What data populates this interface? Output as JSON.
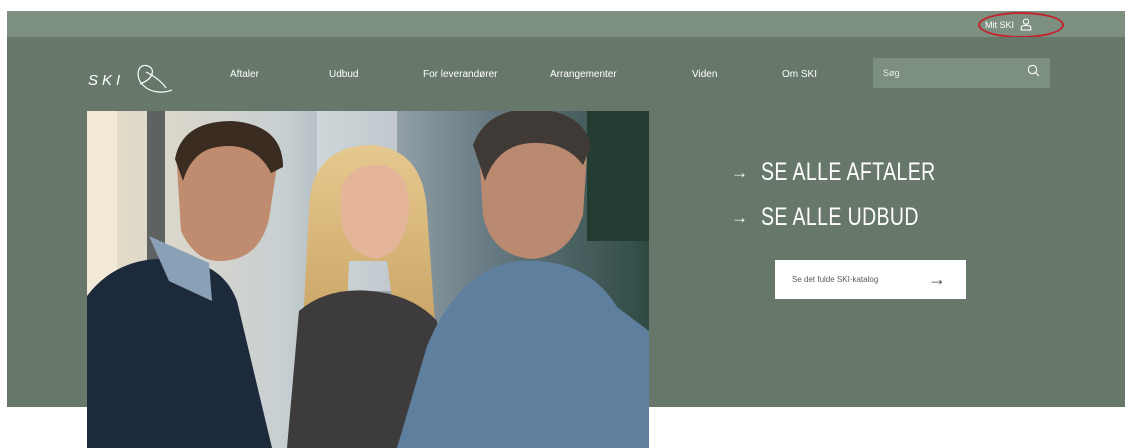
{
  "topbar": {
    "mit_ski_label": "Mit SKI",
    "profile_icon": "user-icon"
  },
  "header": {
    "logo_text": "SKI",
    "nav": [
      {
        "label": "Aftaler"
      },
      {
        "label": "Udbud"
      },
      {
        "label": "For leverandører"
      },
      {
        "label": "Arrangementer"
      },
      {
        "label": "Viden"
      },
      {
        "label": "Om SKI"
      }
    ],
    "search": {
      "placeholder": "Søg",
      "icon": "search-icon"
    }
  },
  "hero": {
    "links": [
      {
        "label": "SE ALLE AFTALER"
      },
      {
        "label": "SE ALLE UDBUD"
      }
    ],
    "catalog_button": "Se det fulde SKI-katalog"
  },
  "colors": {
    "topbar": "#7d8f7f",
    "hero_background": "#67786a",
    "highlight_annotation": "#c2232f"
  }
}
